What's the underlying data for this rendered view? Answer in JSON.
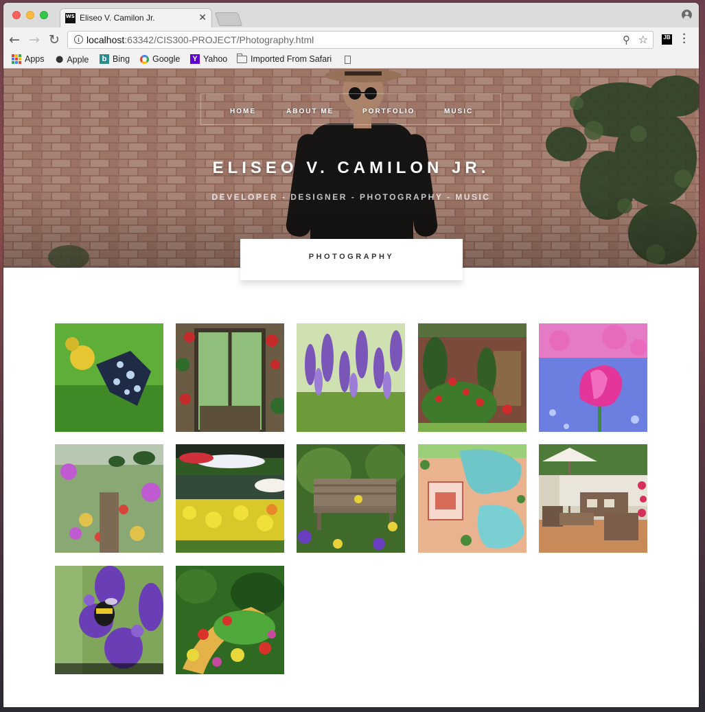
{
  "browser": {
    "tab_title": "Eliseo V. Camilon Jr.",
    "tab_favicon": "WS",
    "url_host": "localhost",
    "url_path": ":63342/CIS300-PROJECT/Photography.html",
    "jb_label": "JB",
    "bookmarks": [
      {
        "label": "Apps",
        "icon": "apps-grid-icon"
      },
      {
        "label": "Apple",
        "icon": "apple-icon"
      },
      {
        "label": "Bing",
        "icon": "bing-icon"
      },
      {
        "label": "Google",
        "icon": "google-icon"
      },
      {
        "label": "Yahoo",
        "icon": "yahoo-icon"
      },
      {
        "label": "Imported From Safari",
        "icon": "folder-icon"
      }
    ]
  },
  "page": {
    "nav": [
      "HOME",
      "ABOUT ME",
      "PORTFOLIO",
      "MUSIC"
    ],
    "title": "ELISEO V. CAMILON JR.",
    "subtitle": "DEVELOPER - DESIGNER - PHOTOGRAPHY - MUSIC",
    "section_title": "PHOTOGRAPHY",
    "gallery": [
      {
        "subject": "butterfly"
      },
      {
        "subject": "greenhouse-door"
      },
      {
        "subject": "lavender-field"
      },
      {
        "subject": "garden-wall"
      },
      {
        "subject": "pink-tulip"
      },
      {
        "subject": "flower-shop"
      },
      {
        "subject": "canal-tulips"
      },
      {
        "subject": "garden-bench"
      },
      {
        "subject": "pool-sketch"
      },
      {
        "subject": "patio-furniture"
      },
      {
        "subject": "bee-lavender"
      },
      {
        "subject": "sunken-garden"
      }
    ]
  },
  "colors": {
    "accent_text": "#333333",
    "hero_brick": "#b88f80",
    "background": "#ffffff"
  }
}
